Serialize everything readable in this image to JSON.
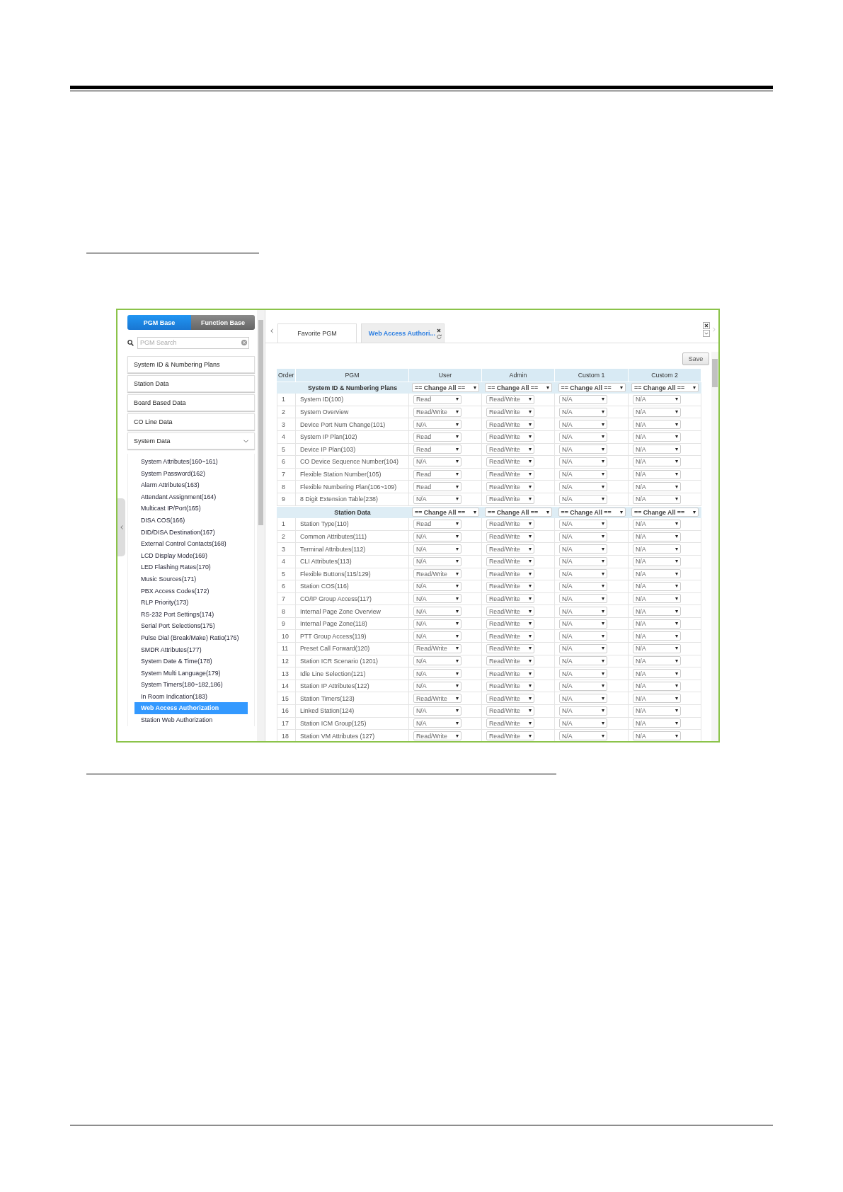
{
  "sidebar": {
    "tabs": [
      {
        "label": "PGM Base",
        "selected": true
      },
      {
        "label": "Function Base",
        "selected": false
      }
    ],
    "search": {
      "placeholder": "PGM Search"
    },
    "groups": [
      {
        "label": "System ID & Numbering Plans",
        "expanded": false
      },
      {
        "label": "Station Data",
        "expanded": false
      },
      {
        "label": "Board Based Data",
        "expanded": false
      },
      {
        "label": "CO Line Data",
        "expanded": false
      },
      {
        "label": "System Data",
        "expanded": true,
        "children": [
          {
            "label": "System Attributes(160~161)",
            "selected": false
          },
          {
            "label": "System Password(162)",
            "selected": false
          },
          {
            "label": "Alarm Attributes(163)",
            "selected": false
          },
          {
            "label": "Attendant Assignment(164)",
            "selected": false
          },
          {
            "label": "Multicast IP/Port(165)",
            "selected": false
          },
          {
            "label": "DISA COS(166)",
            "selected": false
          },
          {
            "label": "DID/DISA Destination(167)",
            "selected": false
          },
          {
            "label": "External Control Contacts(168)",
            "selected": false
          },
          {
            "label": "LCD Display Mode(169)",
            "selected": false
          },
          {
            "label": "LED Flashing Rates(170)",
            "selected": false
          },
          {
            "label": "Music Sources(171)",
            "selected": false
          },
          {
            "label": "PBX Access Codes(172)",
            "selected": false
          },
          {
            "label": "RLP Priority(173)",
            "selected": false
          },
          {
            "label": "RS-232 Port Settings(174)",
            "selected": false
          },
          {
            "label": "Serial Port Selections(175)",
            "selected": false
          },
          {
            "label": "Pulse Dial (Break/Make) Ratio(176)",
            "selected": false
          },
          {
            "label": "SMDR Attributes(177)",
            "selected": false
          },
          {
            "label": "System Date & Time(178)",
            "selected": false
          },
          {
            "label": "System Multi Language(179)",
            "selected": false
          },
          {
            "label": "System Timers(180~182,186)",
            "selected": false
          },
          {
            "label": "In Room Indication(183)",
            "selected": false
          },
          {
            "label": "Web Access Authorization",
            "selected": true
          },
          {
            "label": "Station Web Authorization",
            "selected": false
          }
        ]
      }
    ]
  },
  "tabs": [
    {
      "label": "Favorite PGM",
      "selected": false
    },
    {
      "label": "Web Access Authori...",
      "selected": true
    }
  ],
  "save": "Save",
  "table": {
    "columns": [
      "Order",
      "PGM",
      "User",
      "Admin",
      "Custom 1",
      "Custom 2"
    ],
    "sections": [
      {
        "title": "System ID & Numbering Plans",
        "change_all": [
          "== Change All ==",
          "== Change All ==",
          "== Change All ==",
          "== Change All =="
        ],
        "rows": [
          {
            "order": "1",
            "pgm": "System ID(100)",
            "values": [
              "Read",
              "Read/Write",
              "N/A",
              "N/A"
            ]
          },
          {
            "order": "2",
            "pgm": "System Overview",
            "values": [
              "Read/Write",
              "Read/Write",
              "N/A",
              "N/A"
            ]
          },
          {
            "order": "3",
            "pgm": "Device Port Num Change(101)",
            "values": [
              "N/A",
              "Read/Write",
              "N/A",
              "N/A"
            ]
          },
          {
            "order": "4",
            "pgm": "System IP Plan(102)",
            "values": [
              "Read",
              "Read/Write",
              "N/A",
              "N/A"
            ]
          },
          {
            "order": "5",
            "pgm": "Device IP Plan(103)",
            "values": [
              "Read",
              "Read/Write",
              "N/A",
              "N/A"
            ]
          },
          {
            "order": "6",
            "pgm": "CO Device Sequence Number(104)",
            "values": [
              "N/A",
              "Read/Write",
              "N/A",
              "N/A"
            ]
          },
          {
            "order": "7",
            "pgm": "Flexible Station Number(105)",
            "values": [
              "Read",
              "Read/Write",
              "N/A",
              "N/A"
            ]
          },
          {
            "order": "8",
            "pgm": "Flexible Numbering Plan(106~109)",
            "values": [
              "Read",
              "Read/Write",
              "N/A",
              "N/A"
            ]
          },
          {
            "order": "9",
            "pgm": "8 Digit Extension Table(238)",
            "values": [
              "N/A",
              "Read/Write",
              "N/A",
              "N/A"
            ]
          }
        ]
      },
      {
        "title": "Station Data",
        "change_all": [
          "== Change All ==",
          "== Change All ==",
          "== Change All ==",
          "== Change All =="
        ],
        "rows": [
          {
            "order": "1",
            "pgm": "Station Type(110)",
            "values": [
              "Read",
              "Read/Write",
              "N/A",
              "N/A"
            ]
          },
          {
            "order": "2",
            "pgm": "Common Attributes(111)",
            "values": [
              "N/A",
              "Read/Write",
              "N/A",
              "N/A"
            ]
          },
          {
            "order": "3",
            "pgm": "Terminal Attributes(112)",
            "values": [
              "N/A",
              "Read/Write",
              "N/A",
              "N/A"
            ]
          },
          {
            "order": "4",
            "pgm": "CLI Attributes(113)",
            "values": [
              "N/A",
              "Read/Write",
              "N/A",
              "N/A"
            ]
          },
          {
            "order": "5",
            "pgm": "Flexible Buttons(115/129)",
            "values": [
              "Read/Write",
              "Read/Write",
              "N/A",
              "N/A"
            ]
          },
          {
            "order": "6",
            "pgm": "Station COS(116)",
            "values": [
              "N/A",
              "Read/Write",
              "N/A",
              "N/A"
            ]
          },
          {
            "order": "7",
            "pgm": "CO/IP Group Access(117)",
            "values": [
              "N/A",
              "Read/Write",
              "N/A",
              "N/A"
            ]
          },
          {
            "order": "8",
            "pgm": "Internal Page Zone Overview",
            "values": [
              "N/A",
              "Read/Write",
              "N/A",
              "N/A"
            ]
          },
          {
            "order": "9",
            "pgm": "Internal Page Zone(118)",
            "values": [
              "N/A",
              "Read/Write",
              "N/A",
              "N/A"
            ]
          },
          {
            "order": "10",
            "pgm": "PTT Group Access(119)",
            "values": [
              "N/A",
              "Read/Write",
              "N/A",
              "N/A"
            ]
          },
          {
            "order": "11",
            "pgm": "Preset Call Forward(120)",
            "values": [
              "Read/Write",
              "Read/Write",
              "N/A",
              "N/A"
            ]
          },
          {
            "order": "12",
            "pgm": "Station ICR Scenario (1201)",
            "values": [
              "N/A",
              "Read/Write",
              "N/A",
              "N/A"
            ]
          },
          {
            "order": "13",
            "pgm": "Idle Line Selection(121)",
            "values": [
              "N/A",
              "Read/Write",
              "N/A",
              "N/A"
            ]
          },
          {
            "order": "14",
            "pgm": "Station IP Attributes(122)",
            "values": [
              "N/A",
              "Read/Write",
              "N/A",
              "N/A"
            ]
          },
          {
            "order": "15",
            "pgm": "Station Timers(123)",
            "values": [
              "Read/Write",
              "Read/Write",
              "N/A",
              "N/A"
            ]
          },
          {
            "order": "16",
            "pgm": "Linked Station(124)",
            "values": [
              "N/A",
              "Read/Write",
              "N/A",
              "N/A"
            ]
          },
          {
            "order": "17",
            "pgm": "Station ICM Group(125)",
            "values": [
              "N/A",
              "Read/Write",
              "N/A",
              "N/A"
            ]
          },
          {
            "order": "18",
            "pgm": "Station VM Attributes (127)",
            "values": [
              "Read/Write",
              "Read/Write",
              "N/A",
              "N/A"
            ]
          }
        ]
      }
    ]
  }
}
